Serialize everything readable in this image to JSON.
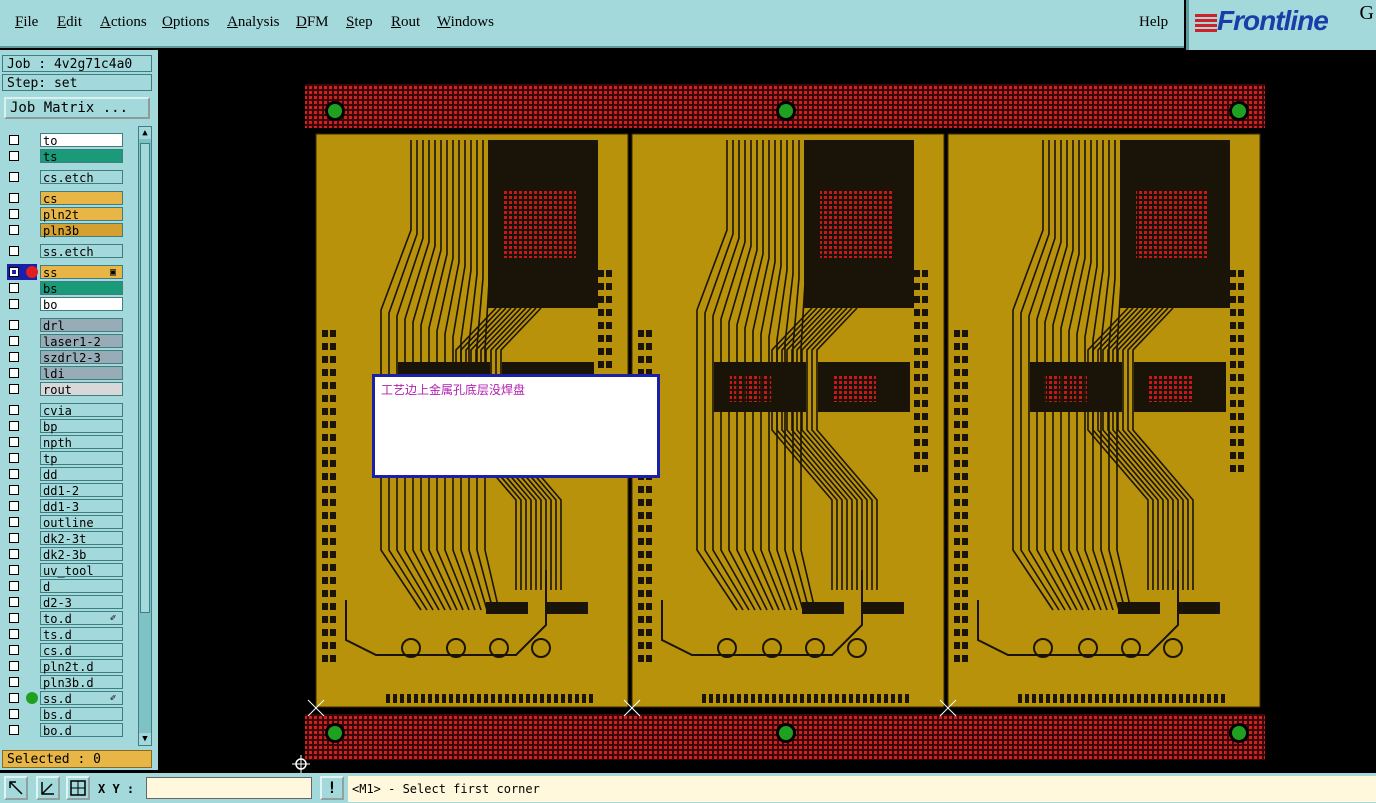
{
  "menu": [
    "File",
    "Edit",
    "Actions",
    "Options",
    "Analysis",
    "DFM",
    "Step",
    "Rout",
    "Windows"
  ],
  "menu_underline": [
    "F",
    "E",
    "A",
    "O",
    "A",
    "D",
    "S",
    "R",
    "W"
  ],
  "help": "Help",
  "logo": {
    "text": "Frontline",
    "corner": "G",
    "stripe_color": "#d0202a",
    "text_color": "#1a3ea8"
  },
  "job_label": "Job : 4v2g71c4a0",
  "step_label": "Step: set",
  "job_matrix": "Job Matrix ...",
  "layers": [
    {
      "name": "to",
      "color": "#ffffff",
      "group": 1
    },
    {
      "name": "ts",
      "color": "#1a9a78",
      "group": 1
    },
    {
      "name": "cs.etch",
      "color": "#a4d9dc",
      "group": 2
    },
    {
      "name": "cs",
      "color": "#e8b646",
      "group": 3
    },
    {
      "name": "pln2t",
      "color": "#e8b646",
      "group": 3
    },
    {
      "name": "pln3b",
      "color": "#d4a030",
      "group": 3
    },
    {
      "name": "ss.etch",
      "color": "#a4d9dc",
      "group": 4
    },
    {
      "name": "ss",
      "color": "#e8b646",
      "group": 5,
      "active": true,
      "dot": "#e02020",
      "mark": "▣"
    },
    {
      "name": "bs",
      "color": "#1a9a78",
      "group": 5
    },
    {
      "name": "bo",
      "color": "#ffffff",
      "group": 5
    },
    {
      "name": "drl",
      "color": "#98acb8",
      "group": 6
    },
    {
      "name": "laser1-2",
      "color": "#98acb8",
      "group": 6
    },
    {
      "name": "szdrl2-3",
      "color": "#98acb8",
      "group": 6
    },
    {
      "name": "ldi",
      "color": "#98acb8",
      "group": 6
    },
    {
      "name": "rout",
      "color": "#d8d8d8",
      "group": 6
    },
    {
      "name": "cvia",
      "color": "#a4d9dc",
      "group": 7
    },
    {
      "name": "bp",
      "color": "#a4d9dc",
      "group": 7
    },
    {
      "name": "npth",
      "color": "#a4d9dc",
      "group": 7
    },
    {
      "name": "tp",
      "color": "#a4d9dc",
      "group": 7
    },
    {
      "name": "dd",
      "color": "#a4d9dc",
      "group": 7
    },
    {
      "name": "dd1-2",
      "color": "#a4d9dc",
      "group": 7
    },
    {
      "name": "dd1-3",
      "color": "#a4d9dc",
      "group": 7
    },
    {
      "name": "outline",
      "color": "#a4d9dc",
      "group": 7
    },
    {
      "name": "dk2-3t",
      "color": "#a4d9dc",
      "group": 7
    },
    {
      "name": "dk2-3b",
      "color": "#a4d9dc",
      "group": 7
    },
    {
      "name": "uv_tool",
      "color": "#a4d9dc",
      "group": 7
    },
    {
      "name": "d",
      "color": "#a4d9dc",
      "group": 7
    },
    {
      "name": "d2-3",
      "color": "#a4d9dc",
      "group": 7
    },
    {
      "name": "to.d",
      "color": "#a4d9dc",
      "group": 7,
      "mark": "✐"
    },
    {
      "name": "ts.d",
      "color": "#a4d9dc",
      "group": 7
    },
    {
      "name": "cs.d",
      "color": "#a4d9dc",
      "group": 7
    },
    {
      "name": "pln2t.d",
      "color": "#a4d9dc",
      "group": 7
    },
    {
      "name": "pln3b.d",
      "color": "#a4d9dc",
      "group": 7
    },
    {
      "name": "ss.d",
      "color": "#a4d9dc",
      "group": 7,
      "dot": "#20a020",
      "mark": "✐"
    },
    {
      "name": "bs.d",
      "color": "#a4d9dc",
      "group": 7
    },
    {
      "name": "bo.d",
      "color": "#a4d9dc",
      "group": 7
    }
  ],
  "selected": "Selected : 0",
  "xy_label": "X Y :",
  "xy_value": "",
  "excl": "!",
  "prompt": "<M1> - Select first corner",
  "note_text": "工艺边上金属孔底层没焊盘",
  "colors": {
    "board": "#b8920a",
    "trace": "#1a1408",
    "pad_red": "#c81818",
    "frame_red": "#d02020",
    "panel_bg": "#a4d9dc",
    "fiducial": "#20a020"
  }
}
